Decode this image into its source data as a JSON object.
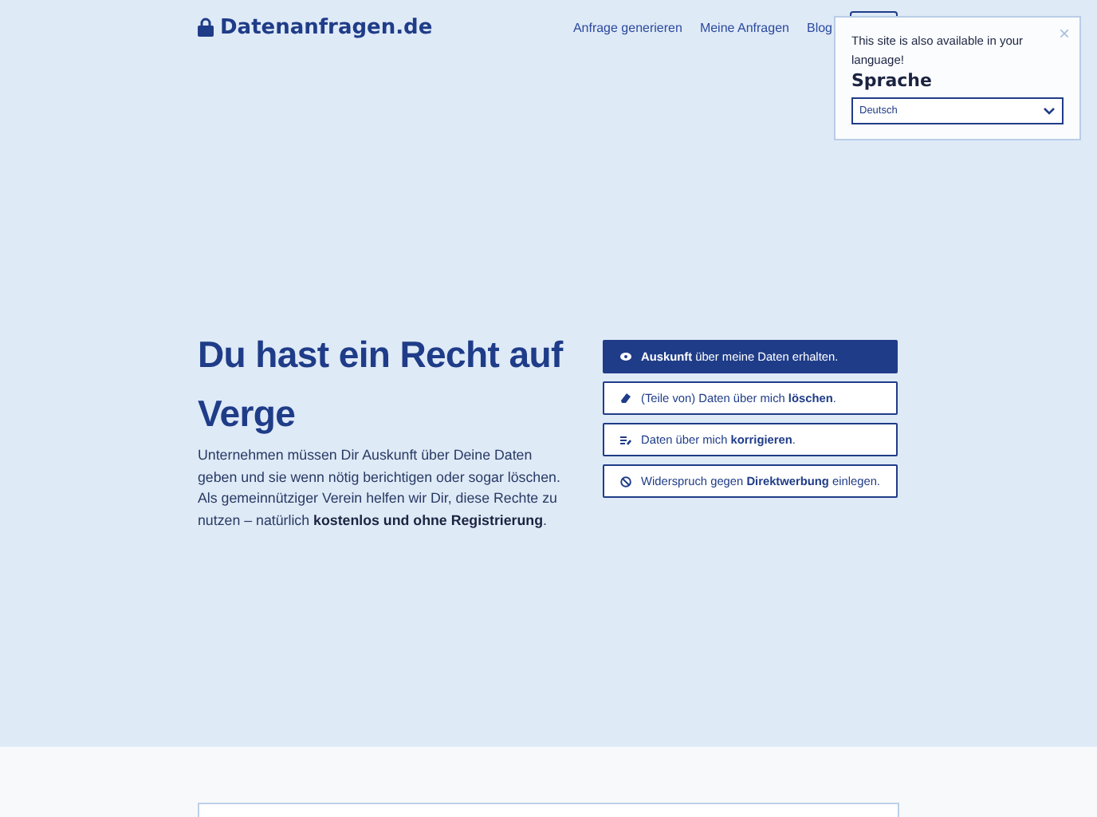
{
  "header": {
    "logo": "Datenanfragen.de",
    "nav": [
      "Anfrage generieren",
      "Meine Anfragen",
      "Blog"
    ]
  },
  "language_popup": {
    "message": "This site is also available in your language!",
    "heading": "Sprache",
    "select": {
      "value": "Deutsch"
    },
    "close": "×"
  },
  "hero": {
    "heading": "Du hast ein Recht auf Verge",
    "paragraphs": [
      "Unternehmen müssen Dir Auskunft über Deine Daten geben und sie wenn nötig berichtigen oder sogar löschen.",
      "Als gemeinnütziger Verein helfen wir Dir, diese Rechte zu nutzen – natürlich **kostenlos und ohne Registrierung**."
    ]
  },
  "actions": [
    {
      "kind": "access",
      "primary": true,
      "label": "**Auskunft** über meine Daten erhalten."
    },
    {
      "kind": "erase",
      "primary": false,
      "label": "(Teile von) Daten über mich **löschen**."
    },
    {
      "kind": "rectify",
      "primary": false,
      "label": "Daten über mich **korrigieren**."
    },
    {
      "kind": "object",
      "primary": false,
      "label": "Widerspruch gegen **Direktwerbung** einlegen."
    }
  ]
}
